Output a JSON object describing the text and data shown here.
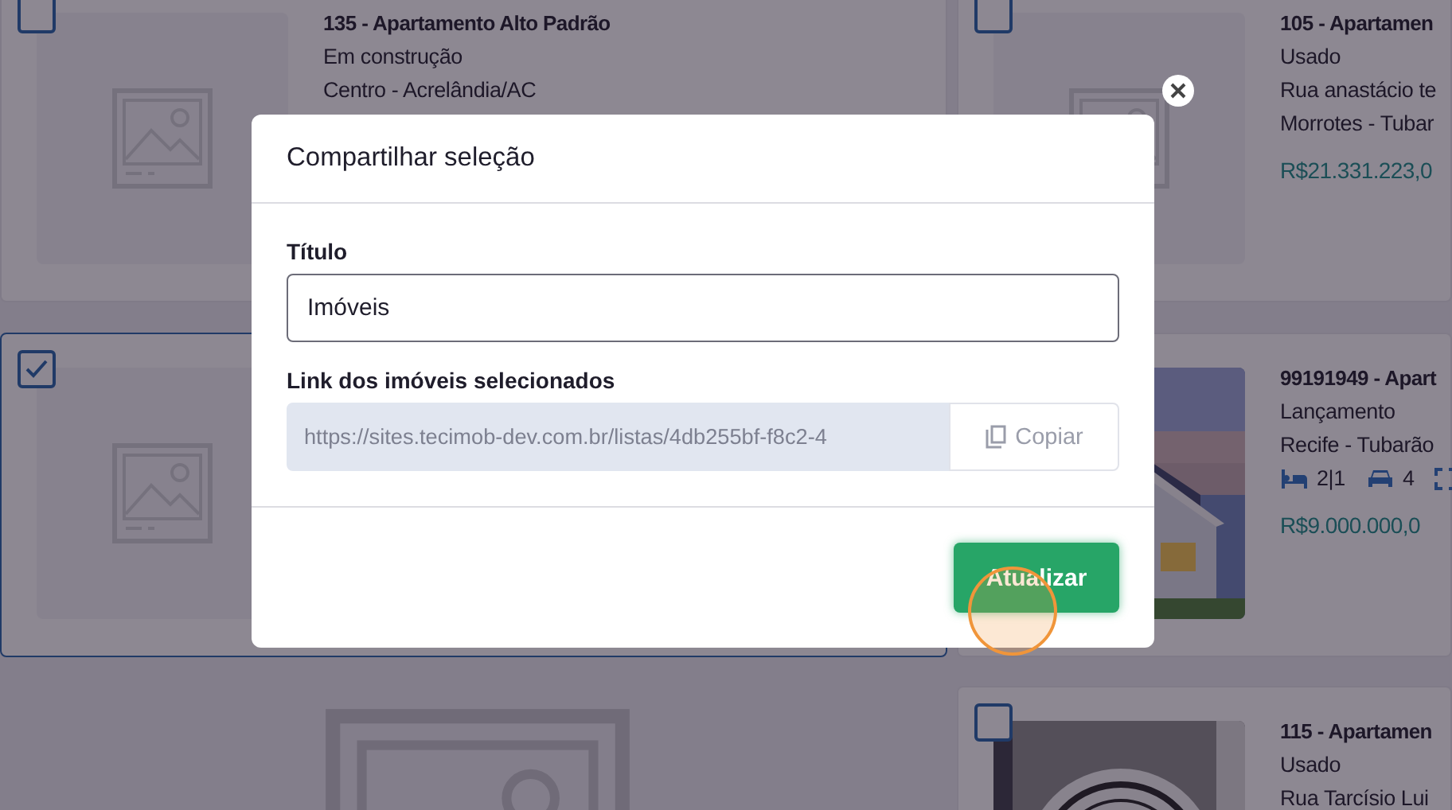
{
  "listing_columns": [
    {
      "cards": [
        {
          "kind": "listing",
          "selected": false,
          "image": {
            "kind": "placeholder"
          },
          "title": "135 - Apartamento Alto Padrão",
          "lines": [
            "Em construção",
            "Centro - Acrelândia/AC"
          ]
        },
        {
          "kind": "listing",
          "selected": true,
          "image": {
            "kind": "placeholder"
          }
        },
        {
          "kind": "media",
          "image": {
            "kind": "placeholder"
          }
        }
      ]
    },
    {
      "cards": [
        {
          "kind": "listing",
          "selected": false,
          "image": {
            "kind": "placeholder"
          },
          "title": "105 - Apartamen",
          "lines": [
            "Usado",
            "Rua anastácio te",
            "Morrotes - Tubar"
          ],
          "price": "R$21.331.223,0"
        },
        {
          "kind": "listing",
          "image": {
            "kind": "house"
          },
          "title": "99191949 - Apart",
          "lines": [
            "Lançamento",
            "Recife - Tubarão"
          ],
          "features": [
            {
              "kind": "bedrooms",
              "text": "2|1"
            },
            {
              "kind": "parking",
              "text": "4"
            },
            {
              "kind": "area"
            }
          ],
          "price": "R$9.000.000,0"
        },
        {
          "kind": "listing",
          "selected": false,
          "image": {
            "kind": "sign"
          },
          "title": "115 - Apartamen",
          "lines": [
            "Usado",
            "Rua Tarcísio Lui"
          ]
        }
      ]
    }
  ],
  "modal": {
    "title": "Compartilhar seleção",
    "title_field": {
      "label": "Título",
      "value": "Imóveis"
    },
    "link_field": {
      "label": "Link dos imóveis selecionados",
      "value": "https://sites.tecimob-dev.com.br/listas/4db255bf-f8c2-4",
      "copy_button": "Copiar"
    },
    "primary_button": "Atualizar"
  }
}
